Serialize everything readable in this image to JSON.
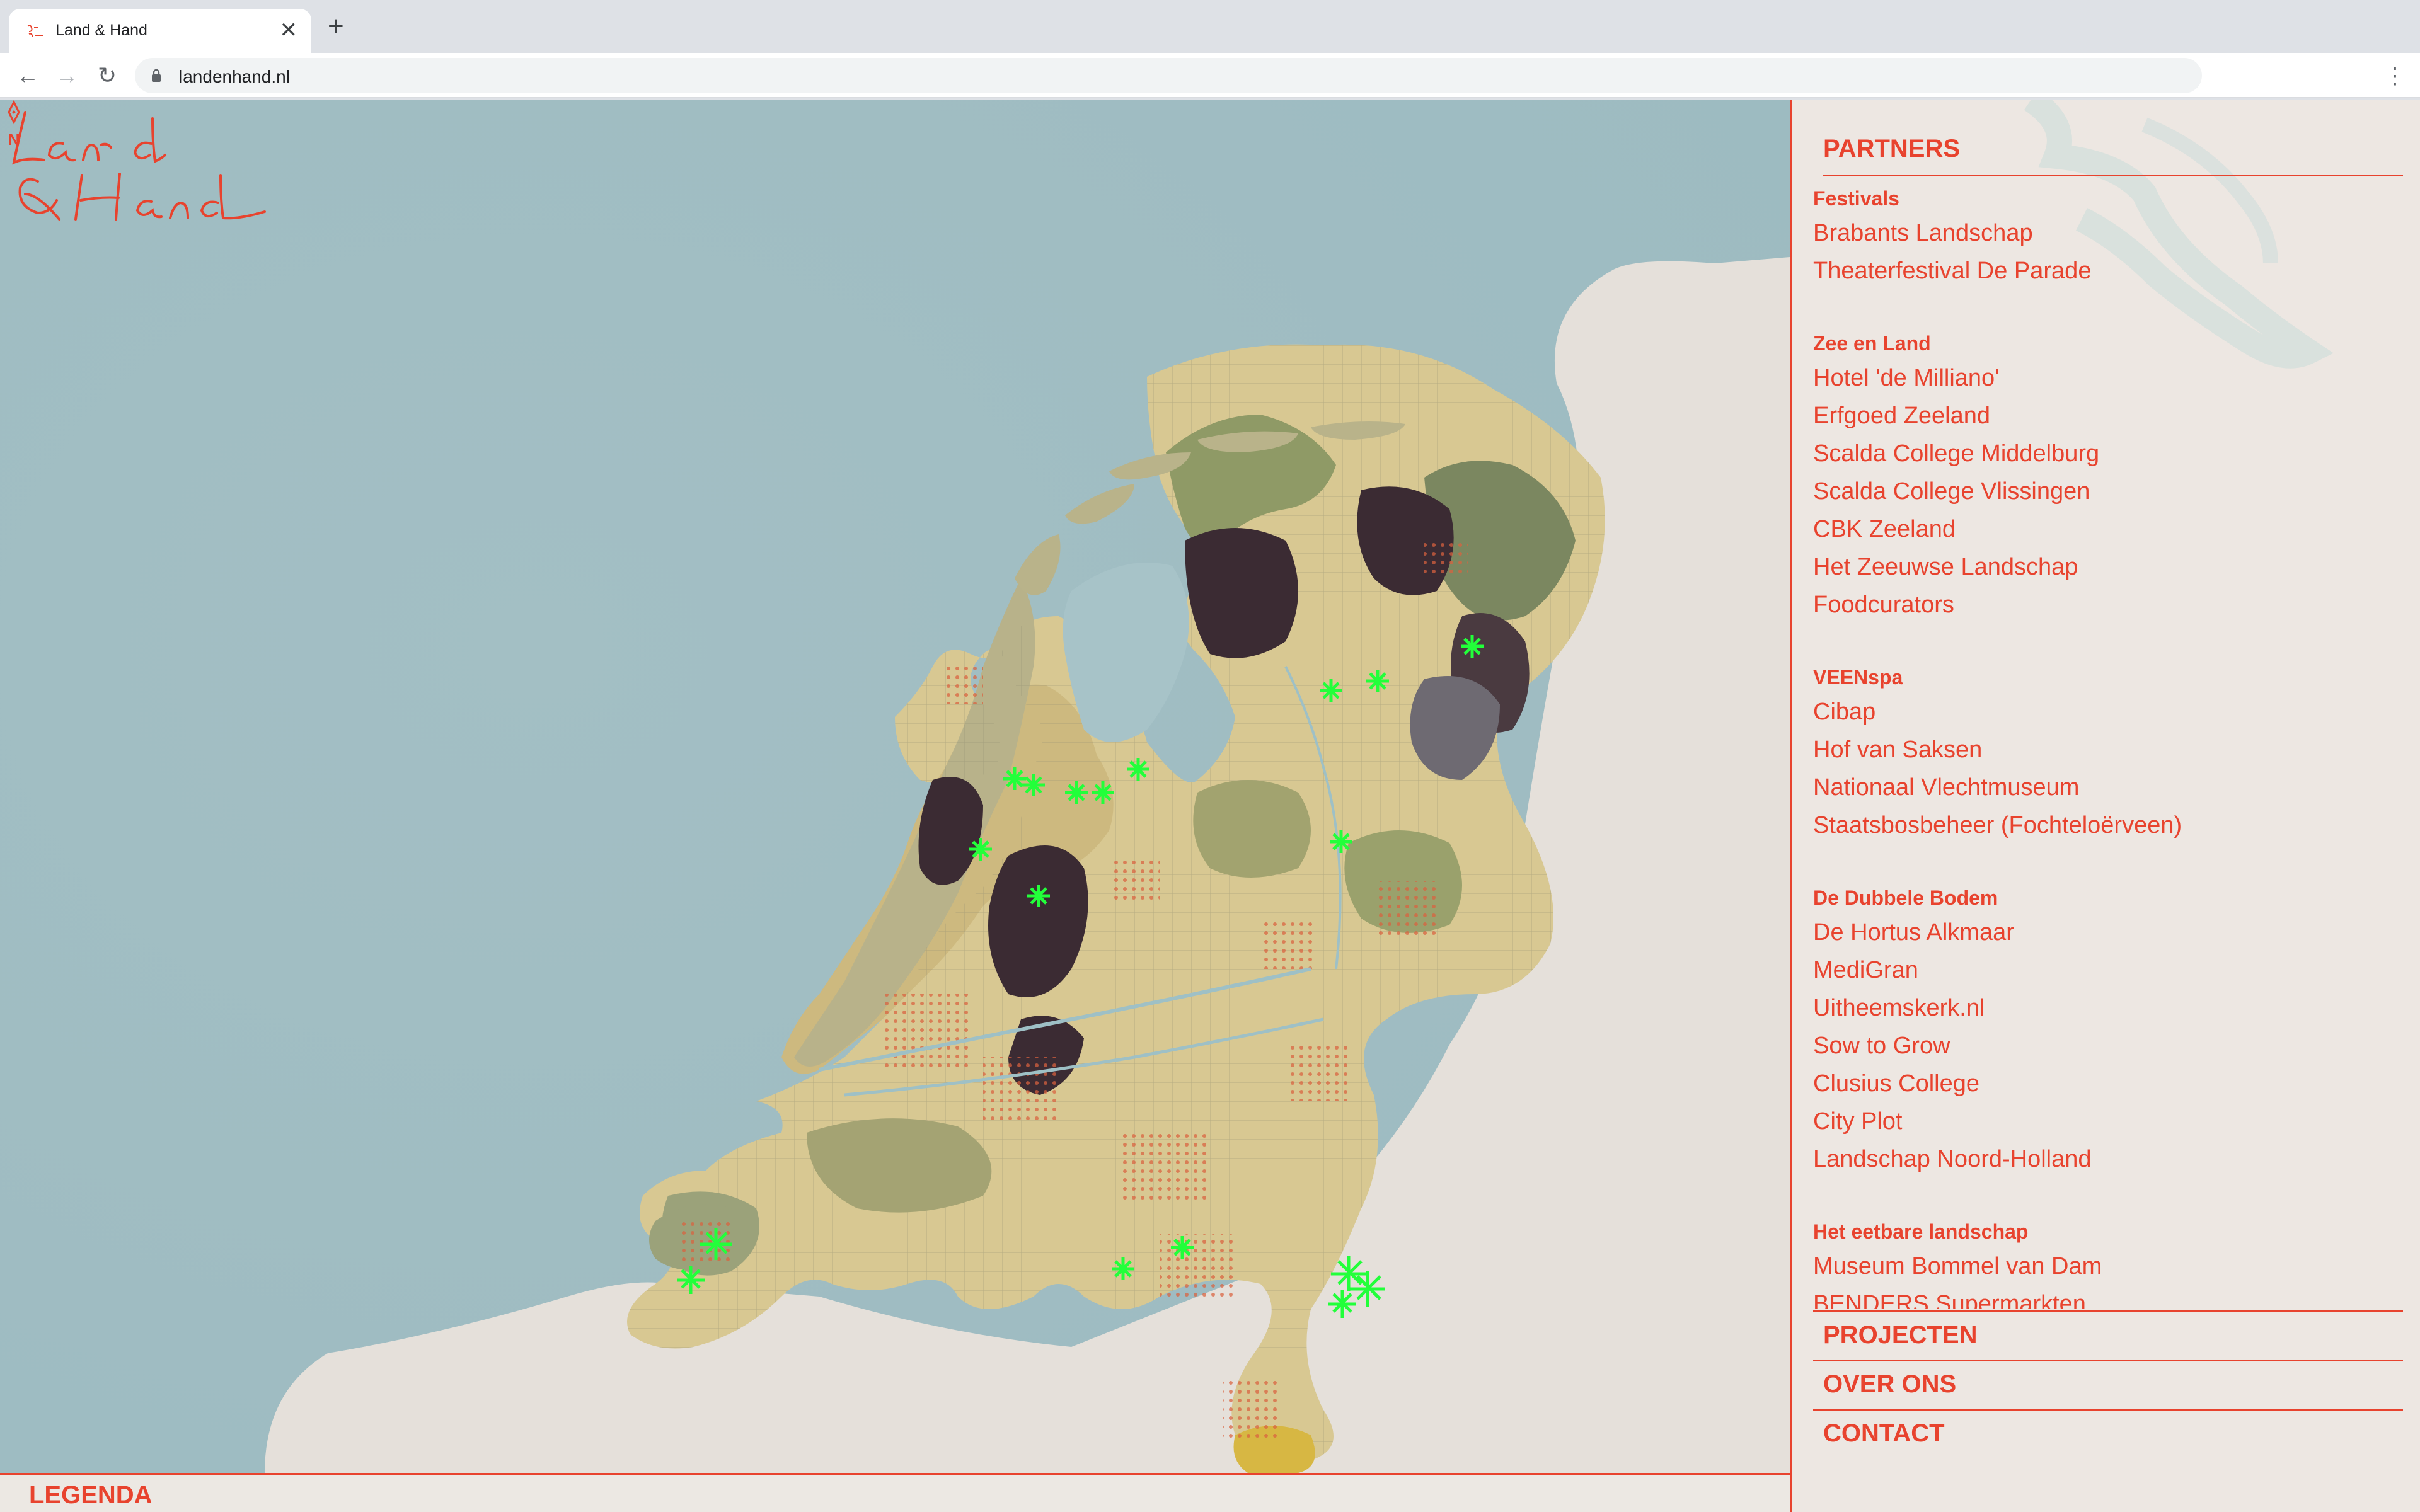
{
  "browser": {
    "tab_title": "Land & Hand",
    "url": "landenhand.nl",
    "tab_close": "✕",
    "new_tab": "+",
    "back": "←",
    "forward": "→",
    "reload": "↻",
    "menu": "⋮"
  },
  "logo": {
    "line1": "Land",
    "line2": "& Hand",
    "color": "#e8432e"
  },
  "map": {
    "compass_label": "N",
    "marker_color": "#22ff3a"
  },
  "legend": {
    "label": "LEGENDA"
  },
  "sidebar": {
    "partners_title": "PARTNERS",
    "groups": [
      {
        "title": "Festivals",
        "links": [
          "Brabants Landschap",
          "Theaterfestival De Parade"
        ]
      },
      {
        "title": "Zee en Land",
        "links": [
          "Hotel 'de Milliano'",
          "Erfgoed Zeeland",
          "Scalda College Middelburg",
          "Scalda College Vlissingen",
          "CBK Zeeland",
          "Het Zeeuwse Landschap",
          "Foodcurators"
        ]
      },
      {
        "title": "VEENspa",
        "links": [
          "Cibap",
          "Hof van Saksen",
          "Nationaal Vlechtmuseum",
          "Staatsbosbeheer (Fochteloërveen)"
        ]
      },
      {
        "title": "De Dubbele Bodem",
        "links": [
          "De Hortus Alkmaar",
          "MediGran",
          "Uitheemskerk.nl",
          "Sow to Grow",
          "Clusius College",
          "City Plot",
          "Landschap Noord-Holland"
        ]
      },
      {
        "title": "Het eetbare landschap",
        "links": [
          "Museum Bommel van Dam",
          "BENDERS Supermarkten"
        ]
      }
    ],
    "nav": {
      "projecten": "PROJECTEN",
      "over_ons": "OVER ONS",
      "contact": "CONTACT"
    },
    "accent": "#e8432e"
  }
}
